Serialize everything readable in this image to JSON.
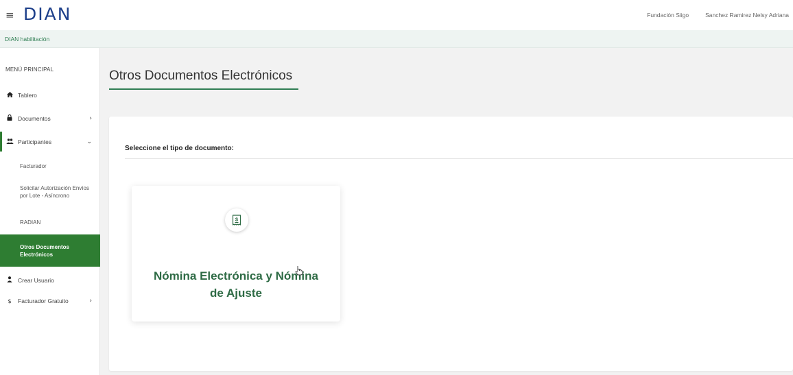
{
  "header": {
    "menu_icon": "hamburger-icon",
    "logo_text": "DIAN",
    "user_company": "Fundación Siigo",
    "user_name": "Sanchez Ramirez Nelsy Adriana"
  },
  "environment_label": "DIAN habilitación",
  "sidebar": {
    "title": "MENÚ PRINCIPAL",
    "items": [
      {
        "label": "Tablero",
        "icon": "home-icon"
      },
      {
        "label": "Documentos",
        "icon": "lock-icon",
        "chevron": "›"
      },
      {
        "label": "Participantes",
        "icon": "users-icon",
        "chevron": "⌄"
      },
      {
        "label": "Crear Usuario",
        "icon": "user-add-icon"
      },
      {
        "label": "Facturador Gratuito",
        "icon": "dollar-icon",
        "icon_glyph": "$",
        "chevron": "›"
      }
    ],
    "sub_items": [
      {
        "label": "Facturador"
      },
      {
        "label": "Solicitar Autorización Envíos por Lote - Asíncrono"
      },
      {
        "label": "RADIAN"
      },
      {
        "label": "Otros Documentos Electrónicos",
        "active": true
      }
    ]
  },
  "main": {
    "title": "Otros Documentos Electrónicos",
    "select_label": "Seleccione el tipo de documento:",
    "card": {
      "icon": "receipt-dollar-icon",
      "label": "Nómina Electrónica y Nómina de Ajuste"
    }
  },
  "colors": {
    "accent_green": "#2e7d32",
    "title_green": "#2e6b45",
    "logo_blue": "#1d3f8a"
  }
}
